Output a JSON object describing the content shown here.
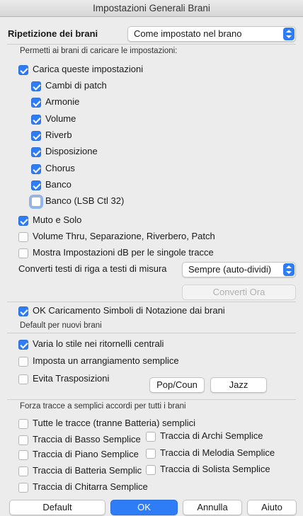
{
  "window": {
    "title": "Impostazioni Generali Brani"
  },
  "repeat": {
    "label": "Ripetizione dei brani",
    "value": "Come impostato nel brano"
  },
  "load_section": {
    "heading": "Permetti ai brani di caricare le impostazioni:",
    "load_all": {
      "label": "Carica queste impostazioni",
      "checked": true
    },
    "items": [
      {
        "label": "Cambi di patch",
        "checked": true
      },
      {
        "label": "Armonie",
        "checked": true
      },
      {
        "label": "Volume",
        "checked": true
      },
      {
        "label": "Riverb",
        "checked": true
      },
      {
        "label": "Disposizione",
        "checked": true
      },
      {
        "label": "Chorus",
        "checked": true
      },
      {
        "label": "Banco",
        "checked": true
      },
      {
        "label": "Banco (LSB Ctl 32)",
        "checked": false
      }
    ],
    "mute_solo": {
      "label": "Muto e Solo",
      "checked": true
    },
    "volume_thru": {
      "label": "Volume Thru, Separazione, Riverbero, Patch",
      "checked": false
    },
    "db_settings": {
      "label": "Mostra Impostazioni dB per le singole tracce",
      "checked": false
    }
  },
  "convert": {
    "label": "Converti testi di riga a testi di misura",
    "value": "Sempre (auto-dividi)",
    "button": "Converti Ora"
  },
  "notation": {
    "label": "OK Caricamento Simboli di Notazione dai brani",
    "checked": true
  },
  "defaults": {
    "heading": "Default per nuovi brani",
    "vary_style": {
      "label": "Varia lo stile nei ritornelli centrali",
      "checked": true
    },
    "simple_arr": {
      "label": "Imposta un arrangiamento semplice",
      "checked": false
    },
    "avoid_transp": {
      "label": "Evita Trasposizioni",
      "checked": false
    },
    "pop_button": "Pop/Coun",
    "jazz_button": "Jazz"
  },
  "force": {
    "heading": "Forza tracce a semplici accordi per tutti i brani",
    "all_tracks": {
      "label": "Tutte le tracce (tranne Batteria) semplici",
      "checked": false
    },
    "bass": {
      "label": "Traccia di Basso Semplice",
      "checked": false
    },
    "strings": {
      "label": "Traccia di Archi Semplice",
      "checked": false
    },
    "piano": {
      "label": "Traccia di Piano Semplice",
      "checked": false
    },
    "melody": {
      "label": "Traccia di Melodia Semplice",
      "checked": false
    },
    "drums": {
      "label": "Traccia di Batteria Semplic",
      "checked": false
    },
    "soloist": {
      "label": "Traccia di Solista Semplice",
      "checked": false
    },
    "guitar": {
      "label": "Traccia di Chitarra Semplice",
      "checked": false
    }
  },
  "footer": {
    "default": "Default",
    "ok": "OK",
    "cancel": "Annulla",
    "help": "Aiuto"
  }
}
